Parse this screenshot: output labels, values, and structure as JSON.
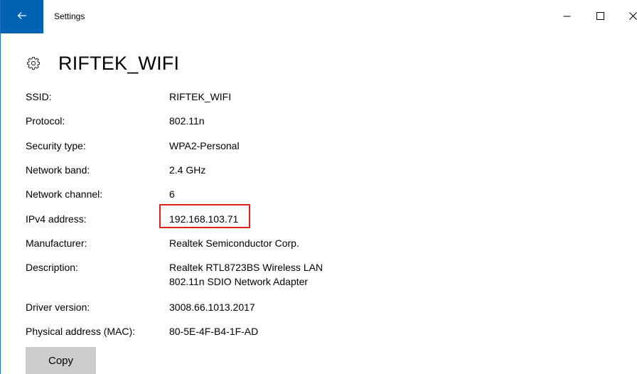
{
  "window": {
    "app_title": "Settings",
    "colors": {
      "accent": "#0063b1",
      "highlight_border": "#e02020",
      "button_bg": "#cccccc"
    }
  },
  "titlebar": {
    "back_icon": "back-arrow-icon",
    "minimize_icon": "minimize-icon",
    "maximize_icon": "maximize-icon",
    "close_icon": "close-icon"
  },
  "header": {
    "icon": "gear-icon",
    "title": "RIFTEK_WIFI"
  },
  "properties": [
    {
      "label": "SSID:",
      "value": "RIFTEK_WIFI"
    },
    {
      "label": "Protocol:",
      "value": "802.11n"
    },
    {
      "label": "Security type:",
      "value": "WPA2-Personal"
    },
    {
      "label": "Network band:",
      "value": "2.4 GHz"
    },
    {
      "label": "Network channel:",
      "value": "6"
    },
    {
      "label": "IPv4 address:",
      "value": "192.168.103.71",
      "highlighted": true
    },
    {
      "label": "Manufacturer:",
      "value": "Realtek Semiconductor Corp."
    },
    {
      "label": "Description:",
      "value_lines": [
        "Realtek RTL8723BS Wireless LAN",
        "802.11n SDIO Network Adapter"
      ]
    },
    {
      "label": "Driver version:",
      "value": "3008.66.1013.2017"
    },
    {
      "label": "Physical address (MAC):",
      "value": "80-5E-4F-B4-1F-AD"
    }
  ],
  "actions": {
    "copy_label": "Copy"
  }
}
